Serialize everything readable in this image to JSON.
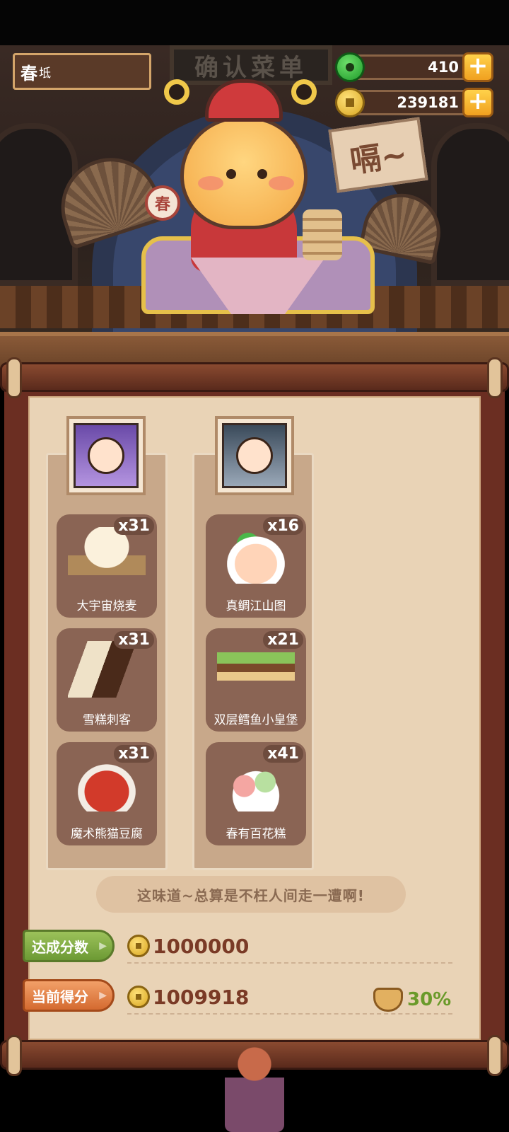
{
  "scene": {
    "signboard": "确认菜单",
    "speech_bubble": "嗝~",
    "drum_label": "春"
  },
  "player": {
    "name_main": "春",
    "name_sub": "坻"
  },
  "currency": {
    "jade": "410",
    "coins": "239181"
  },
  "guests": [
    {
      "portrait": "guest-purple-hair",
      "dishes": [
        {
          "name": "大宇宙烧麦",
          "count": "x31",
          "icon": "shaomai"
        },
        {
          "name": "雪糕刺客",
          "count": "x31",
          "icon": "ice-cream"
        },
        {
          "name": "魔术熊猫豆腐",
          "count": "x31",
          "icon": "mapo-tofu"
        }
      ]
    },
    {
      "portrait": "guest-dark-hair",
      "dishes": [
        {
          "name": "真鲷江山图",
          "count": "x16",
          "icon": "sea-bream"
        },
        {
          "name": "双层鳕鱼小皇堡",
          "count": "x21",
          "icon": "cod-burger"
        },
        {
          "name": "春有百花糕",
          "count": "x41",
          "icon": "flower-cake"
        }
      ]
    }
  ],
  "quote": "这味道~总算是不枉人间走一遭啊!",
  "score": {
    "target_label": "达成分数",
    "target_value": "1000000",
    "current_label": "当前得分",
    "current_value": "1009918",
    "bonus": "30%"
  }
}
